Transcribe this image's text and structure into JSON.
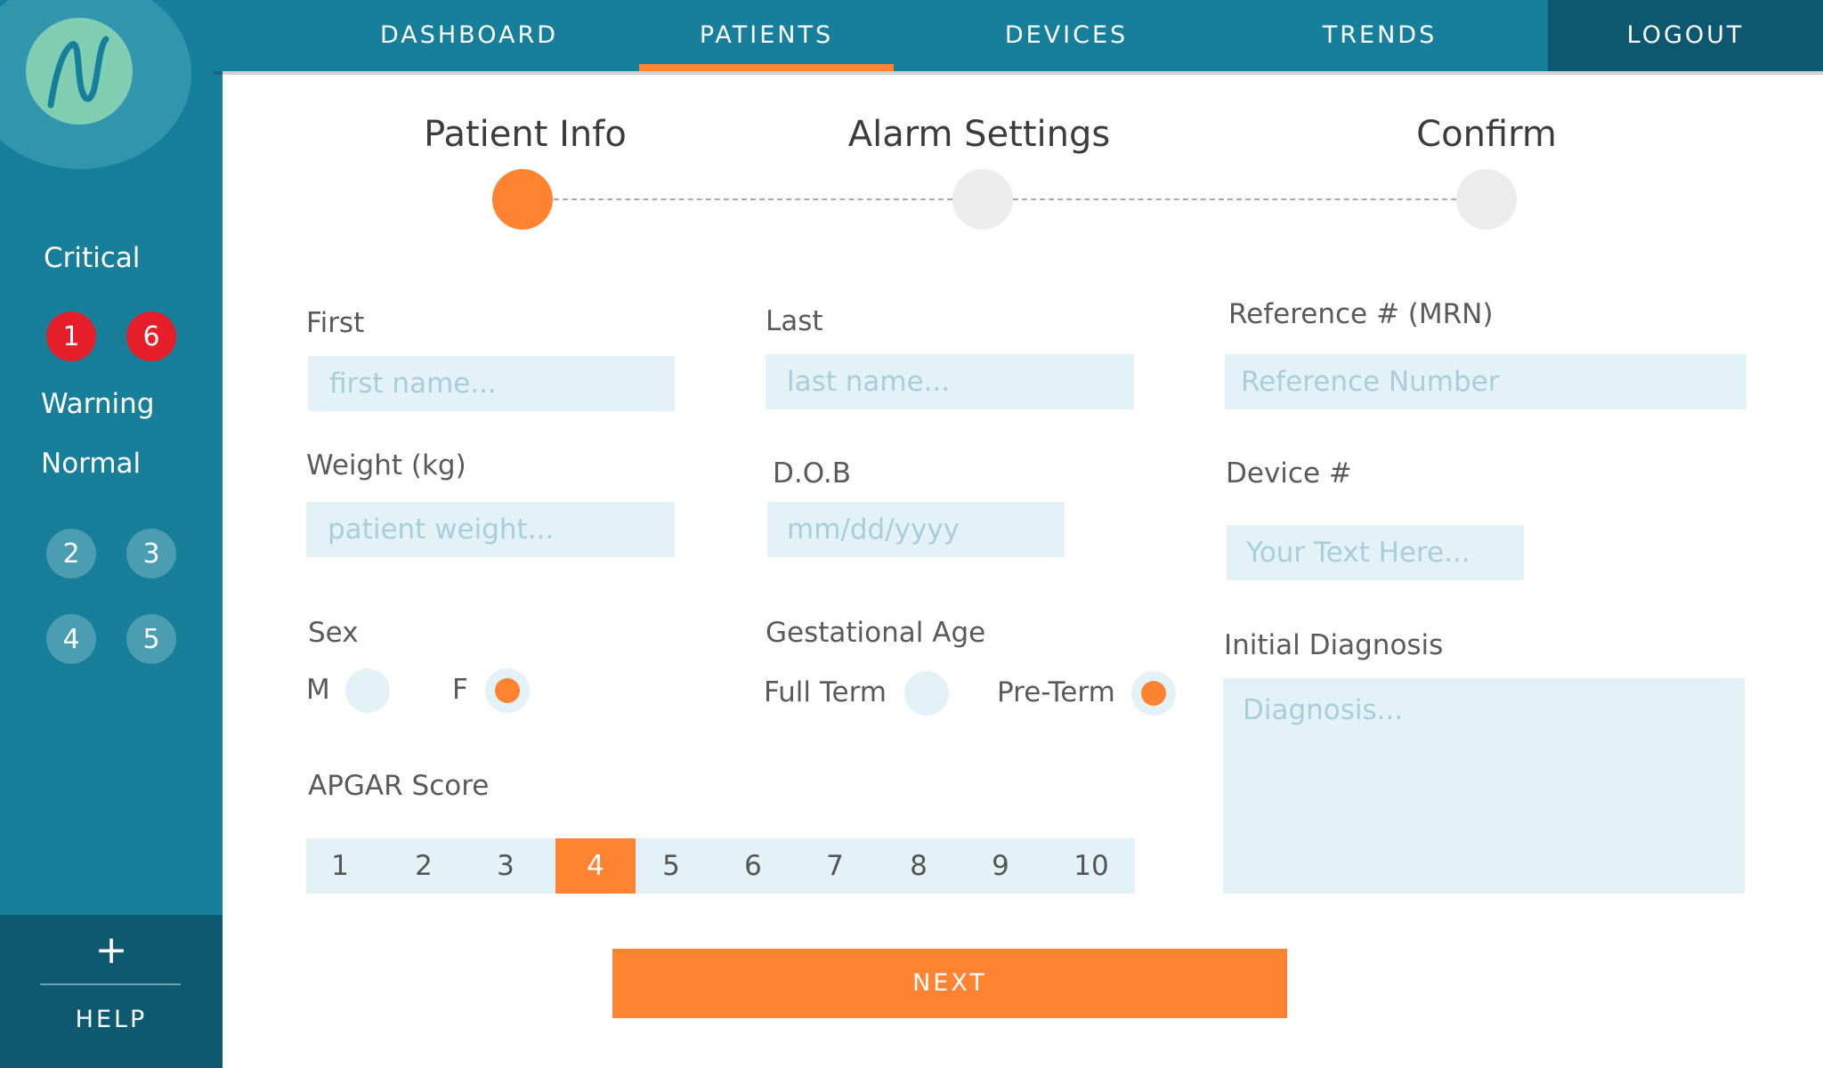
{
  "nav": {
    "items": [
      "DASHBOARD",
      "PATIENTS",
      "DEVICES",
      "TRENDS"
    ],
    "active": "PATIENTS",
    "logout": "LOGOUT"
  },
  "sidebar": {
    "critical_label": "Critical",
    "critical_badges": [
      "1",
      "6"
    ],
    "warning_label": "Warning",
    "normal_label": "Normal",
    "normal_badges": [
      "2",
      "3",
      "4",
      "5"
    ],
    "help_icon": "+",
    "help_label": "HELP"
  },
  "stepper": {
    "steps": [
      "Patient Info",
      "Alarm Settings",
      "Confirm"
    ],
    "active_step": "Patient Info"
  },
  "form": {
    "first": {
      "label": "First",
      "placeholder": "first name..."
    },
    "last": {
      "label": "Last",
      "placeholder": "last name..."
    },
    "reference": {
      "label": "Reference # (MRN)",
      "placeholder": "Reference Number"
    },
    "weight": {
      "label": "Weight (kg)",
      "placeholder": "patient weight..."
    },
    "dob": {
      "label": "D.O.B",
      "placeholder": "mm/dd/yyyy"
    },
    "device": {
      "label": "Device #",
      "placeholder": "Your Text Here..."
    },
    "sex": {
      "label": "Sex",
      "options": [
        "M",
        "F"
      ],
      "selected": "F"
    },
    "gestational_age": {
      "label": "Gestational Age",
      "options": [
        "Full Term",
        "Pre-Term"
      ],
      "selected": "Pre-Term"
    },
    "diagnosis": {
      "label": "Initial Diagnosis",
      "placeholder": "Diagnosis..."
    },
    "apgar": {
      "label": "APGAR Score",
      "options": [
        "1",
        "2",
        "3",
        "4",
        "5",
        "6",
        "7",
        "8",
        "9",
        "10"
      ],
      "selected": "4"
    }
  },
  "next_button": "NEXT",
  "colors": {
    "primary": "#167f9c",
    "dark": "#0b5870",
    "accent": "#ff8330",
    "critical": "#e61e2a",
    "input_bg": "#e3f2f7"
  }
}
